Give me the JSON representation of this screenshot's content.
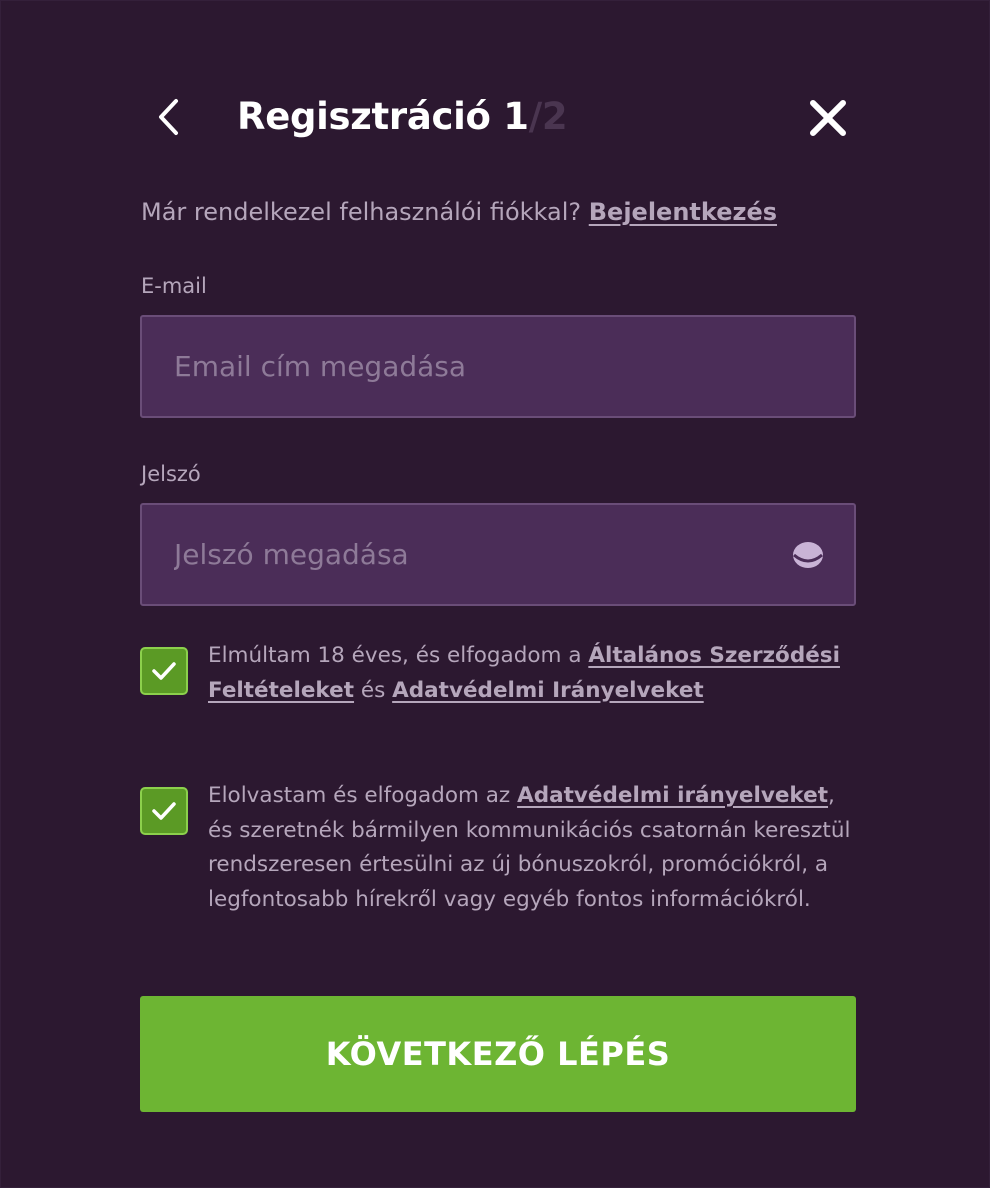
{
  "header": {
    "back_icon": "chevron-left-icon",
    "title_text": "Regisztráció 1",
    "title_step_total": "/2",
    "close_icon": "close-icon"
  },
  "login_prompt": {
    "text": "Már rendelkezel felhasználói fiókkal? ",
    "link_label": "Bejelentkezés"
  },
  "email": {
    "label": "E-mail",
    "placeholder": "Email cím megadása",
    "value": ""
  },
  "password": {
    "label": "Jelszó",
    "placeholder": "Jelszó megadása",
    "value": "",
    "toggle_icon": "eye-icon"
  },
  "consent_age": {
    "checked": true,
    "text_part1": "Elmúltam 18 éves, és elfogadom a ",
    "terms_link": "Általános Szerződési Feltételeket",
    "text_part2": " és ",
    "privacy_link": "Adatvédelmi Irányelveket"
  },
  "consent_marketing": {
    "checked": true,
    "text_part1": "Elolvastam és elfogadom az ",
    "privacy_link": "Adatvédelmi irányelveket",
    "text_part2": ", és szeretnék bármilyen kommunikációs csatornán keresztül rendszeresen értesülni az új bónuszokról, promóciókról, a legfontosabb hírekről vagy egyéb fontos információkról."
  },
  "next_button": {
    "label": "KÖVETKEZŐ LÉPÉS"
  },
  "colors": {
    "background": "#2c1830",
    "input_background": "#4b2d58",
    "accent_green": "#6db533",
    "checkbox_green": "#5b9a25",
    "muted_text": "#b5a6bb"
  }
}
